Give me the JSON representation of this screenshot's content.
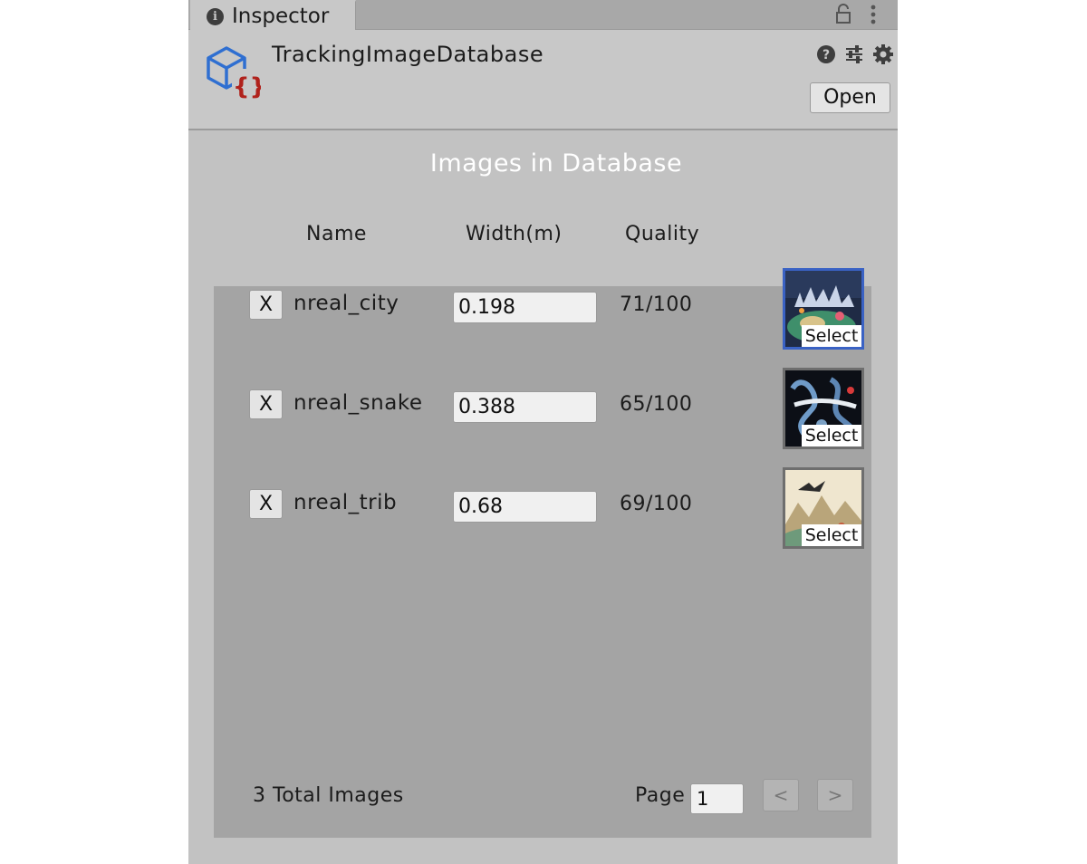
{
  "tab": {
    "label": "Inspector"
  },
  "header": {
    "title": "TrackingImageDatabase",
    "open_label": "Open"
  },
  "database": {
    "heading": "Images in Database",
    "columns": {
      "name": "Name",
      "width": "Width(m)",
      "quality": "Quality"
    },
    "images": [
      {
        "remove_label": "X",
        "name": "nreal_city",
        "width": "0.198",
        "quality": "71/100",
        "select_label": "Select",
        "selected": true
      },
      {
        "remove_label": "X",
        "name": "nreal_snake",
        "width": "0.388",
        "quality": "65/100",
        "select_label": "Select",
        "selected": false
      },
      {
        "remove_label": "X",
        "name": "nreal_trib",
        "width": "0.68",
        "quality": "69/100",
        "select_label": "Select",
        "selected": false
      }
    ],
    "total_text": "3 Total Images",
    "page_label": "Page",
    "page_value": "1",
    "prev_label": "<",
    "next_label": ">"
  },
  "icons": {
    "tab": "info-icon",
    "tab_bar": [
      "lock-icon",
      "kebab-menu-icon"
    ],
    "asset": "scriptable-object-icon",
    "header": [
      "help-icon",
      "preset-icon",
      "gear-icon"
    ]
  },
  "colors": {
    "panel_bg": "#c2c2c2",
    "list_bg": "#a4a4a4",
    "selection_border": "#3a62c4",
    "asset_icon_blue": "#2f6fd1",
    "asset_icon_red": "#b0221c"
  }
}
